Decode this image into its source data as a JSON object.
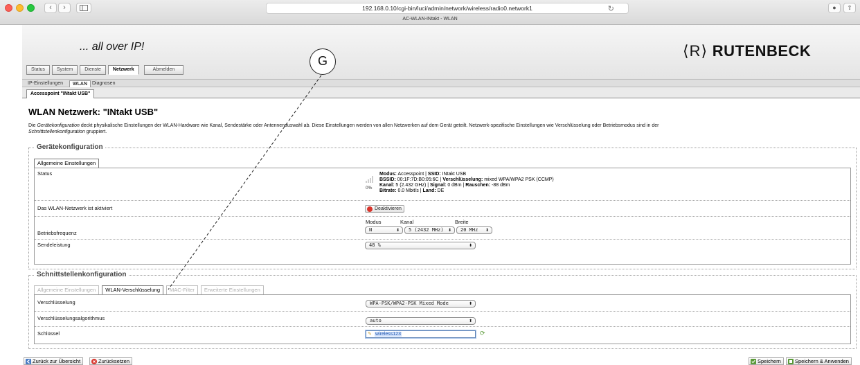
{
  "browser": {
    "url": "192.168.0.10/cgi-bin/luci/admin/network/wireless/radio0.network1",
    "tab_title": "AC-WLAN-INtakt - WLAN",
    "back": "‹",
    "forward": "›"
  },
  "header": {
    "slogan": "... all over IP!",
    "logo_mark": "⟨R⟩",
    "logo_text": "RUTENBECK"
  },
  "menu": {
    "tabs": [
      "Status",
      "System",
      "Dienste",
      "Netzwerk",
      "Abmelden"
    ],
    "active": "Netzwerk"
  },
  "submenu": {
    "tabs": [
      "IP-Einstellungen",
      "WLAN",
      "Diagnosen"
    ],
    "active": "WLAN"
  },
  "ap_tab": "Accesspoint \"INtakt USB\"",
  "page_title": "WLAN Netzwerk: \"INtakt USB\"",
  "description": {
    "part1": "Die ",
    "em1": "Gerätekonfiguration",
    "part2": " deckt physikalische Einstellungen der WLAN-Hardware wie Kanal, Sendestärke oder Antennenauswahl ab. Diese Einstellungen werden von allen Netzwerken auf dem Gerät geteilt. Netzwerk-spezifische Einstellungen wie Verschlüsselung oder Betriebsmodus sind in der ",
    "em2": "Schnittstellenkonfiguration",
    "part3": " gruppiert."
  },
  "device_config": {
    "legend": "Gerätekonfiguration",
    "tab": "Allgemeine Einstellungen",
    "status_label": "Status",
    "signal_percent": "0%",
    "status_lines": {
      "l1a": "Modus:",
      "l1b": " Accesspoint | ",
      "l1c": "SSID:",
      "l1d": " INtakt USB",
      "l2a": "BSSID:",
      "l2b": " 00:1F:7D:B0:05:6C | ",
      "l2c": "Verschlüsselung:",
      "l2d": " mixed WPA/WPA2 PSK (CCMP)",
      "l3a": "Kanal:",
      "l3b": " 5 (2.432 GHz) | ",
      "l3c": "Signal:",
      "l3d": " 0 dBm | ",
      "l3e": "Rauschen:",
      "l3f": " -88 dBm",
      "l4a": "Bitrate:",
      "l4b": " 0.0 Mbit/s | ",
      "l4c": "Land:",
      "l4d": " DE"
    },
    "enabled_label": "Das WLAN-Netzwerk ist aktiviert",
    "deactivate_button": "Deaktivieren",
    "freq_label": "Betriebsfrequenz",
    "freq_headers": {
      "mode": "Modus",
      "channel": "Kanal",
      "width": "Breite"
    },
    "freq_values": {
      "mode": "N",
      "channel": "5 (2432 MHz)",
      "width": "20 MHz"
    },
    "power_label": "Sendeleistung",
    "power_value": "48 %"
  },
  "iface_config": {
    "legend": "Schnittstellenkonfiguration",
    "tabs": [
      "Allgemeine Einstellungen",
      "WLAN-Verschlüsselung",
      "MAC-Filter",
      "Erweiterte Einstellungen"
    ],
    "active": "WLAN-Verschlüsselung",
    "encryption_label": "Verschlüsselung",
    "encryption_value": "WPA-PSK/WPA2-PSK Mixed Mode",
    "algorithm_label": "Verschlüsselungsalgorithmus",
    "algorithm_value": "auto",
    "key_label": "Schlüssel",
    "key_value": "wireless123"
  },
  "footer": {
    "back": "Zurück zur Übersicht",
    "reset": "Zurücksetzen",
    "save": "Speichern",
    "save_apply": "Speichern & Anwenden"
  },
  "callout_label": "G",
  "colors": {
    "red": "#fc5f57",
    "yellow": "#fdbc2e",
    "green": "#27c840",
    "deactivate": "#d9352c",
    "ok": "#5a9a38"
  }
}
